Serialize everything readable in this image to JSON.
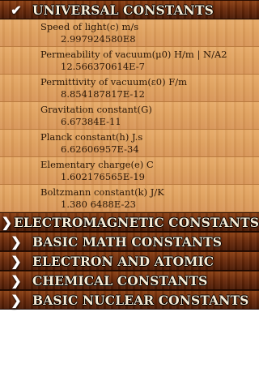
{
  "sections": [
    {
      "title": "UNIVERSAL CONSTANTS",
      "expanded": true,
      "icon": "chevron-down-icon"
    },
    {
      "title": "ELECTROMAGNETIC CONSTANTS",
      "expanded": false,
      "icon": "chevron-right-icon"
    },
    {
      "title": "BASIC MATH CONSTANTS",
      "expanded": false,
      "icon": "chevron-right-icon"
    },
    {
      "title": "ELECTRON AND ATOMIC",
      "expanded": false,
      "icon": "chevron-right-icon"
    },
    {
      "title": "CHEMICAL CONSTANTS",
      "expanded": false,
      "icon": "chevron-right-icon"
    },
    {
      "title": "BASIC NUCLEAR CONSTANTS",
      "expanded": false,
      "icon": "chevron-right-icon"
    }
  ],
  "universal_constants": [
    {
      "label": "Speed of light(c)     m/s",
      "value": "2.997924580E8"
    },
    {
      "label": "Permeability of vacuum(μ0) H/m  |  N/A2",
      "value": "12.566370614E-7"
    },
    {
      "label": "Permittivity of vacuum(ε0)   F/m",
      "value": "8.854187817E-12"
    },
    {
      "label": "Gravitation constant(G)",
      "value": "6.67384E-11"
    },
    {
      "label": "Planck constant(h)  J.s",
      "value": "6.62606957E-34"
    },
    {
      "label": "Elementary charge(e)     C",
      "value": "1.602176565E-19"
    },
    {
      "label": "Boltzmann constant(k) J/K",
      "value": "1.380 6488E-23"
    }
  ],
  "colors": {
    "header_dark": "#6b2a0a",
    "row_light": "#dea05e",
    "header_text": "#f7ecd6",
    "row_text": "#2a1606"
  }
}
